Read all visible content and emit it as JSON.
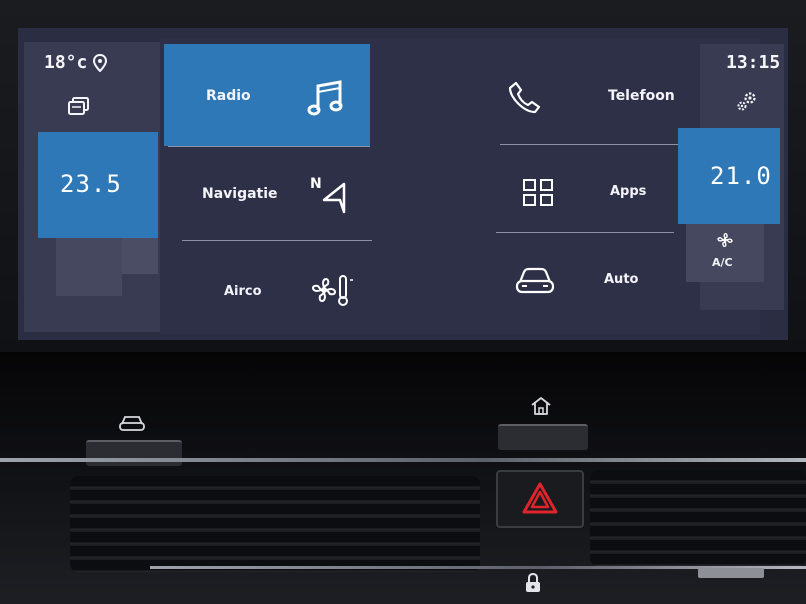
{
  "status": {
    "outside_temp": "18°c",
    "time": "13:15"
  },
  "climate": {
    "driver_temp": "23.5",
    "passenger_temp": "21.0",
    "ac_label": "A/C"
  },
  "menu": {
    "radio": "Radio",
    "navigation": "Navigatie",
    "airco": "Airco",
    "phone": "Telefoon",
    "apps": "Apps",
    "auto": "Auto"
  },
  "icons": {
    "location": "location-pin-icon",
    "media": "media-pages-icon",
    "settings": "gears-icon",
    "music": "music-note-icon",
    "navigation": "compass-arrow-icon",
    "airco": "fan-thermometer-icon",
    "phone": "phone-handset-icon",
    "apps": "app-grid-icon",
    "car": "car-front-icon",
    "fan": "fan-icon",
    "home": "home-icon",
    "hazard": "hazard-triangle-icon",
    "lock": "lock-icon"
  },
  "colors": {
    "accent_blue": "#2e78b7",
    "screen_bg": "#2e3048",
    "hazard_red": "#e0242c"
  }
}
